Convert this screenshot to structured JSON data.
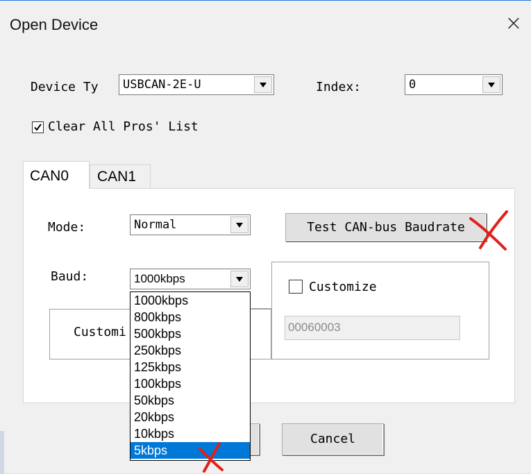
{
  "dialog": {
    "title": "Open Device"
  },
  "device": {
    "type_label": "Device Ty",
    "type_value": "USBCAN-2E-U",
    "index_label": "Index:",
    "index_value": "0",
    "clear_label": "Clear All Pros' List",
    "clear_checked": true
  },
  "tabs": [
    "CAN0",
    "CAN1"
  ],
  "can": {
    "mode_label": "Mode:",
    "mode_value": "Normal",
    "test_button": "Test CAN-bus Baudrate",
    "baud_label": "Baud:",
    "baud_value": "1000kbps",
    "customize_label": "Customize",
    "customize_checked": false,
    "custom_value": "00060003",
    "custom_label_partial": "Customi"
  },
  "baud_options": [
    "1000kbps",
    "800kbps",
    "500kbps",
    "250kbps",
    "125kbps",
    "100kbps",
    "50kbps",
    "20kbps",
    "10kbps",
    "5kbps"
  ],
  "baud_highlighted": "5kbps",
  "footer": {
    "cancel_label": "Cancel"
  },
  "colors": {
    "selection": "#0078d7",
    "annotation": "#e0201a",
    "title_border": "#1e79d6"
  }
}
